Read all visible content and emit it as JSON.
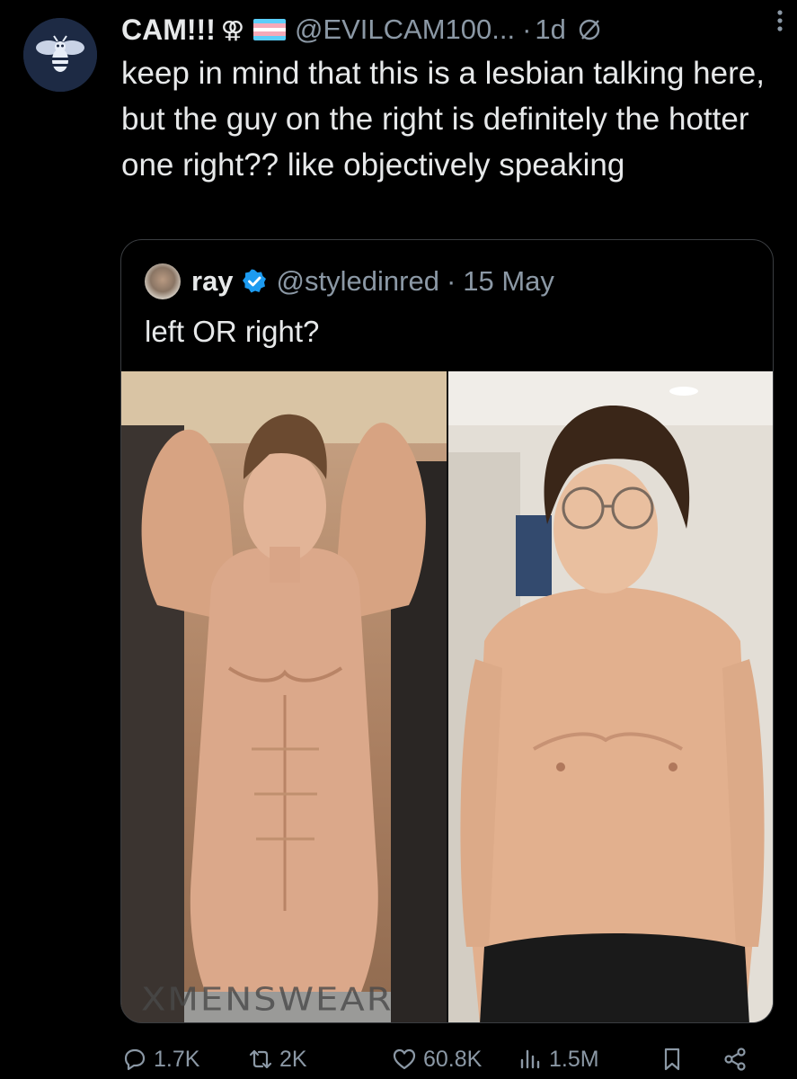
{
  "tweet": {
    "display_name": "CAM!!!",
    "gender_icon": "⚢",
    "handle": "@EVILCAM100...",
    "separator": "·",
    "time": "1d",
    "text": "keep in mind that this is a lesbian talking here, but the guy on the right is definitely the hotter one right?? like objectively speaking",
    "flag_colors": [
      "#5BCEFA",
      "#F5A9B8",
      "#FFFFFF",
      "#F5A9B8",
      "#5BCEFA"
    ]
  },
  "quote": {
    "display_name": "ray",
    "handle": "@styledinred",
    "separator": "·",
    "date": "15 May",
    "text": "left OR right?",
    "media": {
      "left_photo_waistband_text": "XMENSWEAR",
      "left_photo_icon": "shirtless-muscular-man-photo",
      "right_photo_icon": "shirtless-man-with-glasses-photo"
    }
  },
  "actions": {
    "replies": "1.7K",
    "reposts": "2K",
    "likes": "60.8K",
    "views": "1.5M"
  },
  "colors": {
    "background": "#000000",
    "text_primary": "#e7e9ea",
    "text_secondary": "#8b98a5",
    "verified_blue": "#1d9bf0",
    "border": "#3a3d41"
  },
  "icons": [
    "bee-avatar-icon",
    "gender-symbol-icon",
    "trans-flag-icon",
    "grok-icon",
    "more-icon",
    "verified-icon",
    "reply-icon",
    "repost-icon",
    "like-icon",
    "views-icon",
    "bookmark-icon",
    "share-icon"
  ]
}
